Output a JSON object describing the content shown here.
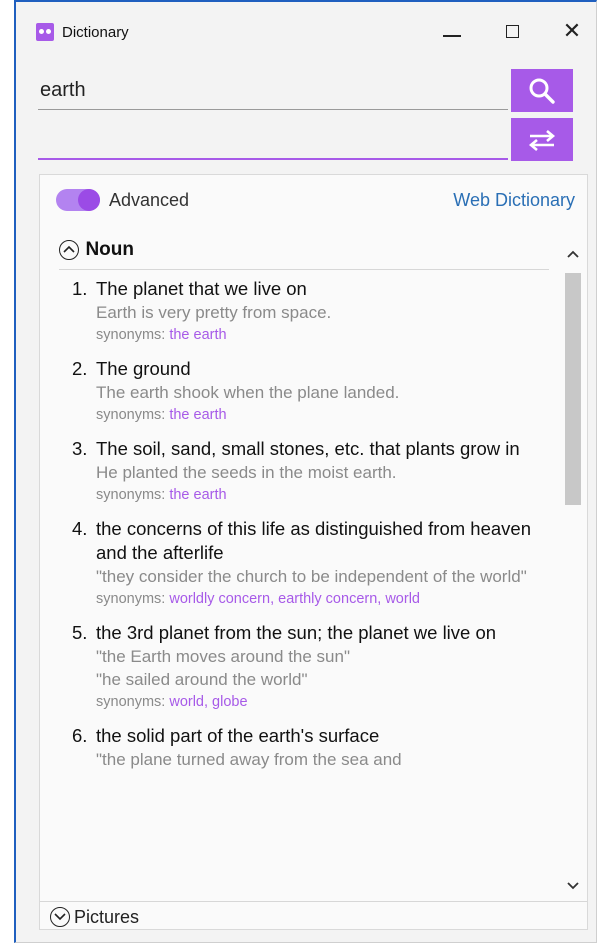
{
  "window": {
    "title": "Dictionary",
    "icons": {
      "app": "dictionary-app-icon",
      "minimize": "minimize-icon",
      "maximize": "maximize-icon",
      "close": "close-icon"
    }
  },
  "search": {
    "value": "earth",
    "secondary_value": ""
  },
  "buttons": {
    "search_icon": "search-icon",
    "swap_icon": "swap-arrows-icon"
  },
  "accent_color": "#a75ae8",
  "link_color": "#2a6fb5",
  "toggle": {
    "label": "Advanced",
    "on": true
  },
  "web_dictionary_label": "Web Dictionary",
  "section": {
    "title": "Noun",
    "state": "expanded"
  },
  "definitions": [
    {
      "number": "1.",
      "text": "The planet that we live on",
      "examples": [
        "Earth is very pretty from space."
      ],
      "synonyms_label": "synonyms: ",
      "synonyms": "the earth"
    },
    {
      "number": "2.",
      "text": "The ground",
      "examples": [
        "The earth shook when the plane landed."
      ],
      "synonyms_label": "synonyms: ",
      "synonyms": "the earth"
    },
    {
      "number": "3.",
      "text": "The soil, sand, small stones, etc. that plants grow in",
      "examples": [
        "He planted the seeds in the moist earth."
      ],
      "synonyms_label": "synonyms: ",
      "synonyms": "the earth"
    },
    {
      "number": "4.",
      "text": "the concerns of this life as distinguished from heaven and the afterlife",
      "examples": [
        "\"they consider the church to be independent of the world\""
      ],
      "synonyms_label": "synonyms: ",
      "synonyms": "worldly concern, earthly concern, world"
    },
    {
      "number": "5.",
      "text": "the 3rd planet from the sun; the planet we live on",
      "examples": [
        "\"the Earth moves around the sun\"",
        "\"he sailed around the world\""
      ],
      "synonyms_label": "synonyms: ",
      "synonyms": "world, globe"
    },
    {
      "number": "6.",
      "text": "the solid part of the earth's surface",
      "examples": [
        "\"the plane turned away from the sea and"
      ],
      "synonyms_label": "",
      "synonyms": ""
    }
  ],
  "pictures_label": "Pictures"
}
